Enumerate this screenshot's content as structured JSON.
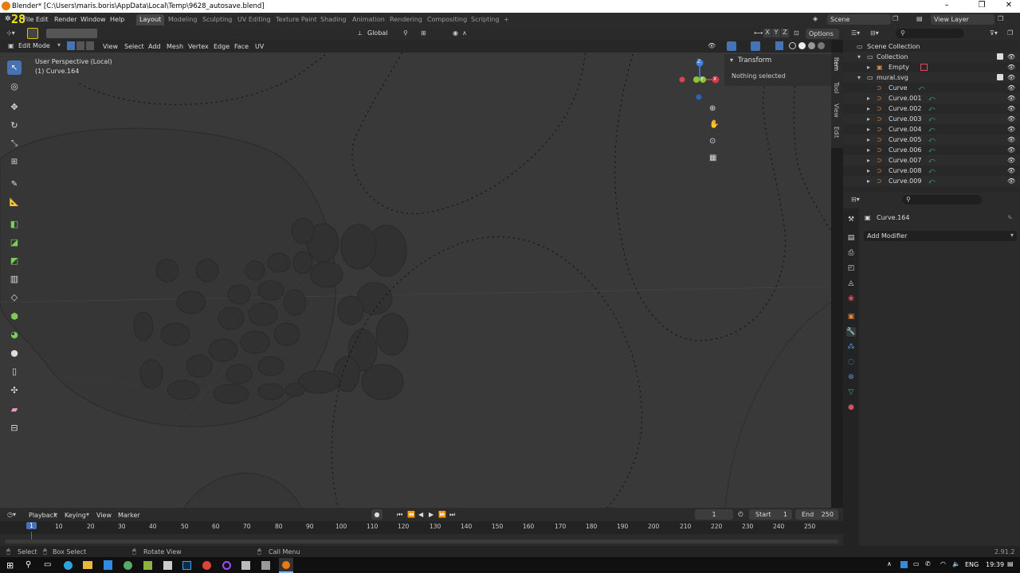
{
  "window": {
    "title": "Blender* [C:\\Users\\maris.boris\\AppData\\Local\\Temp\\9628_autosave.blend]",
    "minimize": "–",
    "maximize": "❐",
    "close": "✕"
  },
  "menu": {
    "items": [
      "File",
      "Edit",
      "Render",
      "Window",
      "Help"
    ],
    "version_badge": "28"
  },
  "workspaces": {
    "tabs": [
      "Layout",
      "Modeling",
      "Sculpting",
      "UV Editing",
      "Texture Paint",
      "Shading",
      "Animation",
      "Rendering",
      "Compositing",
      "Scripting"
    ],
    "active": "Layout",
    "add": "+"
  },
  "scene": {
    "scene_name": "Scene",
    "view_layer": "View Layer"
  },
  "viewport": {
    "transform_orientation": "Global",
    "options_label": "Options",
    "mode": "Edit Mode",
    "header_menus": [
      "View",
      "Select",
      "Add",
      "Mesh",
      "Vertex",
      "Edge",
      "Face",
      "UV"
    ],
    "perspective_label": "User Perspective (Local)",
    "object_label": "(1) Curve.164",
    "axis_labels": {
      "x": "X",
      "y": "Y",
      "z": "Z"
    },
    "xyz": [
      "X",
      "Y",
      "Z"
    ]
  },
  "npanel": {
    "header": "Transform",
    "nothing_selected": "Nothing selected",
    "tabs": [
      "Item",
      "Tool",
      "View",
      "Edit"
    ]
  },
  "outliner": {
    "scene_collection": "Scene Collection",
    "rows": [
      {
        "label": "Collection",
        "indent": 1
      },
      {
        "label": "Empty",
        "indent": 2
      },
      {
        "label": "mural.svg",
        "indent": 1
      },
      {
        "label": "Curve",
        "indent": 2
      },
      {
        "label": "Curve.001",
        "indent": 2
      },
      {
        "label": "Curve.002",
        "indent": 2
      },
      {
        "label": "Curve.003",
        "indent": 2
      },
      {
        "label": "Curve.004",
        "indent": 2
      },
      {
        "label": "Curve.005",
        "indent": 2
      },
      {
        "label": "Curve.006",
        "indent": 2
      },
      {
        "label": "Curve.007",
        "indent": 2
      },
      {
        "label": "Curve.008",
        "indent": 2
      },
      {
        "label": "Curve.009",
        "indent": 2
      }
    ]
  },
  "properties": {
    "object_name": "Curve.164",
    "add_modifier": "Add Modifier"
  },
  "timeline": {
    "menus": [
      "Playback",
      "Keying",
      "View",
      "Marker"
    ],
    "current_frame": "1",
    "start_label": "Start",
    "start_value": "1",
    "end_label": "End",
    "end_value": "250",
    "ticks": [
      "1",
      "10",
      "20",
      "30",
      "40",
      "50",
      "60",
      "70",
      "80",
      "90",
      "100",
      "110",
      "120",
      "130",
      "140",
      "150",
      "160",
      "170",
      "180",
      "190",
      "200",
      "210",
      "220",
      "230",
      "240",
      "250"
    ]
  },
  "statusbar": {
    "select": "Select",
    "box_select": "Box Select",
    "rotate_view": "Rotate View",
    "call_menu": "Call Menu",
    "version": "2.91.2"
  },
  "taskbar": {
    "language": "ENG",
    "time": "19:39"
  },
  "colors": {
    "accent": "#4772b3",
    "x_axis": "#e0424f",
    "y_axis": "#8bc43a",
    "z_axis": "#3d83e5",
    "curve_icon": "#e2893a",
    "curve_data": "#46b09a"
  }
}
